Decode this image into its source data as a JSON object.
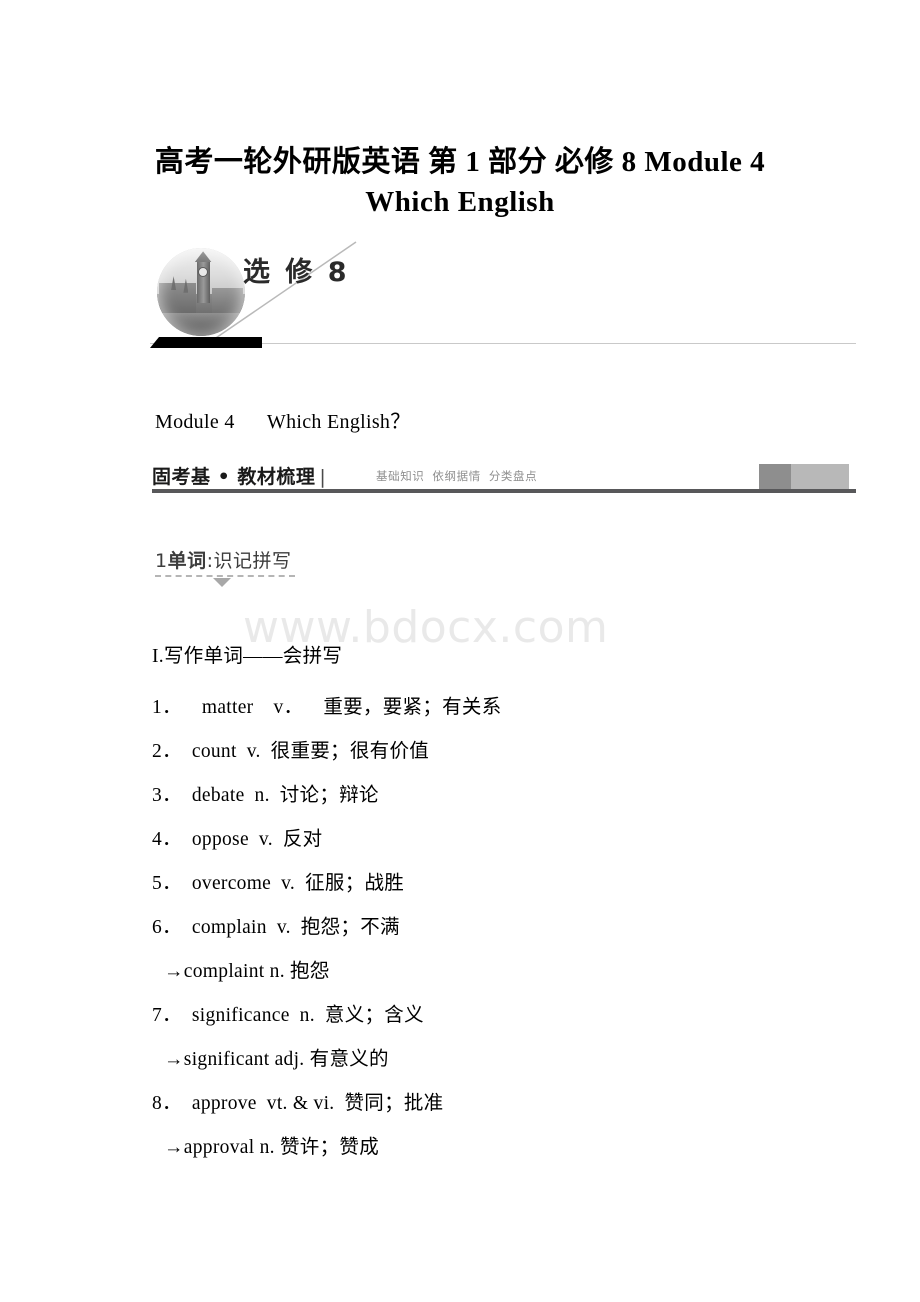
{
  "document": {
    "title_line1": "高考一轮外研版英语 第 1 部分 必修 8 Module 4",
    "title_line2": "Which English",
    "watermark": "www.bdocx.com"
  },
  "badge": {
    "label": "选 修 8",
    "logo_icon": "big-ben-circle-photo-icon"
  },
  "module": {
    "number_label": "Module 4",
    "name_label": "Which English？"
  },
  "banner": {
    "main_left": "固考基 • 教材梳理",
    "divider": "|",
    "sub_items": [
      "基础知识",
      "依纲据情",
      "分类盘点"
    ]
  },
  "subheading": {
    "number": "1",
    "bold_part": "单词",
    "colon": ":",
    "rest": "识记拼写",
    "triangle_icon": "triangle-down-icon"
  },
  "wordlist": {
    "section_title": "I.写作单词——会拼写",
    "items": [
      {
        "index": "1．",
        "word": "matter",
        "pos": "v．",
        "meaning": "重要，要紧；有关系",
        "spacing": "wide",
        "derived": null
      },
      {
        "index": "2．",
        "word": "count",
        "pos": "v.",
        "meaning": "很重要；很有价值",
        "spacing": "normal",
        "derived": null
      },
      {
        "index": "3．",
        "word": "debate",
        "pos": "n.",
        "meaning": "讨论；辩论",
        "spacing": "normal",
        "derived": null
      },
      {
        "index": "4．",
        "word": "oppose",
        "pos": "v.",
        "meaning": "反对",
        "spacing": "normal",
        "derived": null
      },
      {
        "index": "5．",
        "word": "overcome",
        "pos": "v.",
        "meaning": "征服；战胜",
        "spacing": "normal",
        "derived": null
      },
      {
        "index": "6．",
        "word": "complain",
        "pos": "v.",
        "meaning": "抱怨；不满",
        "spacing": "normal",
        "derived": "→complaint n. 抱怨"
      },
      {
        "index": "7．",
        "word": "significance",
        "pos": "n.",
        "meaning": "意义；含义",
        "spacing": "normal",
        "derived": "→significant adj. 有意义的"
      },
      {
        "index": "8．",
        "word": "approve",
        "pos": "vt. & vi.",
        "meaning": "赞同；批准",
        "spacing": "normal",
        "derived": "→approval n. 赞许；赞成"
      }
    ]
  }
}
